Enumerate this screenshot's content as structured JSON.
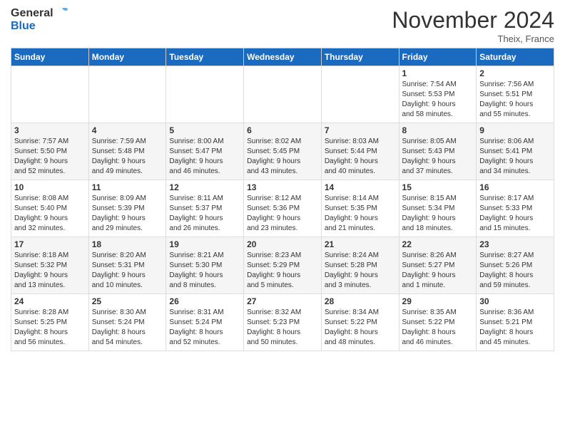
{
  "logo": {
    "line1": "General",
    "line2": "Blue"
  },
  "title": "November 2024",
  "location": "Theix, France",
  "days_of_week": [
    "Sunday",
    "Monday",
    "Tuesday",
    "Wednesday",
    "Thursday",
    "Friday",
    "Saturday"
  ],
  "weeks": [
    [
      {
        "day": "",
        "info": ""
      },
      {
        "day": "",
        "info": ""
      },
      {
        "day": "",
        "info": ""
      },
      {
        "day": "",
        "info": ""
      },
      {
        "day": "",
        "info": ""
      },
      {
        "day": "1",
        "info": "Sunrise: 7:54 AM\nSunset: 5:53 PM\nDaylight: 9 hours\nand 58 minutes."
      },
      {
        "day": "2",
        "info": "Sunrise: 7:56 AM\nSunset: 5:51 PM\nDaylight: 9 hours\nand 55 minutes."
      }
    ],
    [
      {
        "day": "3",
        "info": "Sunrise: 7:57 AM\nSunset: 5:50 PM\nDaylight: 9 hours\nand 52 minutes."
      },
      {
        "day": "4",
        "info": "Sunrise: 7:59 AM\nSunset: 5:48 PM\nDaylight: 9 hours\nand 49 minutes."
      },
      {
        "day": "5",
        "info": "Sunrise: 8:00 AM\nSunset: 5:47 PM\nDaylight: 9 hours\nand 46 minutes."
      },
      {
        "day": "6",
        "info": "Sunrise: 8:02 AM\nSunset: 5:45 PM\nDaylight: 9 hours\nand 43 minutes."
      },
      {
        "day": "7",
        "info": "Sunrise: 8:03 AM\nSunset: 5:44 PM\nDaylight: 9 hours\nand 40 minutes."
      },
      {
        "day": "8",
        "info": "Sunrise: 8:05 AM\nSunset: 5:43 PM\nDaylight: 9 hours\nand 37 minutes."
      },
      {
        "day": "9",
        "info": "Sunrise: 8:06 AM\nSunset: 5:41 PM\nDaylight: 9 hours\nand 34 minutes."
      }
    ],
    [
      {
        "day": "10",
        "info": "Sunrise: 8:08 AM\nSunset: 5:40 PM\nDaylight: 9 hours\nand 32 minutes."
      },
      {
        "day": "11",
        "info": "Sunrise: 8:09 AM\nSunset: 5:39 PM\nDaylight: 9 hours\nand 29 minutes."
      },
      {
        "day": "12",
        "info": "Sunrise: 8:11 AM\nSunset: 5:37 PM\nDaylight: 9 hours\nand 26 minutes."
      },
      {
        "day": "13",
        "info": "Sunrise: 8:12 AM\nSunset: 5:36 PM\nDaylight: 9 hours\nand 23 minutes."
      },
      {
        "day": "14",
        "info": "Sunrise: 8:14 AM\nSunset: 5:35 PM\nDaylight: 9 hours\nand 21 minutes."
      },
      {
        "day": "15",
        "info": "Sunrise: 8:15 AM\nSunset: 5:34 PM\nDaylight: 9 hours\nand 18 minutes."
      },
      {
        "day": "16",
        "info": "Sunrise: 8:17 AM\nSunset: 5:33 PM\nDaylight: 9 hours\nand 15 minutes."
      }
    ],
    [
      {
        "day": "17",
        "info": "Sunrise: 8:18 AM\nSunset: 5:32 PM\nDaylight: 9 hours\nand 13 minutes."
      },
      {
        "day": "18",
        "info": "Sunrise: 8:20 AM\nSunset: 5:31 PM\nDaylight: 9 hours\nand 10 minutes."
      },
      {
        "day": "19",
        "info": "Sunrise: 8:21 AM\nSunset: 5:30 PM\nDaylight: 9 hours\nand 8 minutes."
      },
      {
        "day": "20",
        "info": "Sunrise: 8:23 AM\nSunset: 5:29 PM\nDaylight: 9 hours\nand 5 minutes."
      },
      {
        "day": "21",
        "info": "Sunrise: 8:24 AM\nSunset: 5:28 PM\nDaylight: 9 hours\nand 3 minutes."
      },
      {
        "day": "22",
        "info": "Sunrise: 8:26 AM\nSunset: 5:27 PM\nDaylight: 9 hours\nand 1 minute."
      },
      {
        "day": "23",
        "info": "Sunrise: 8:27 AM\nSunset: 5:26 PM\nDaylight: 8 hours\nand 59 minutes."
      }
    ],
    [
      {
        "day": "24",
        "info": "Sunrise: 8:28 AM\nSunset: 5:25 PM\nDaylight: 8 hours\nand 56 minutes."
      },
      {
        "day": "25",
        "info": "Sunrise: 8:30 AM\nSunset: 5:24 PM\nDaylight: 8 hours\nand 54 minutes."
      },
      {
        "day": "26",
        "info": "Sunrise: 8:31 AM\nSunset: 5:24 PM\nDaylight: 8 hours\nand 52 minutes."
      },
      {
        "day": "27",
        "info": "Sunrise: 8:32 AM\nSunset: 5:23 PM\nDaylight: 8 hours\nand 50 minutes."
      },
      {
        "day": "28",
        "info": "Sunrise: 8:34 AM\nSunset: 5:22 PM\nDaylight: 8 hours\nand 48 minutes."
      },
      {
        "day": "29",
        "info": "Sunrise: 8:35 AM\nSunset: 5:22 PM\nDaylight: 8 hours\nand 46 minutes."
      },
      {
        "day": "30",
        "info": "Sunrise: 8:36 AM\nSunset: 5:21 PM\nDaylight: 8 hours\nand 45 minutes."
      }
    ]
  ]
}
